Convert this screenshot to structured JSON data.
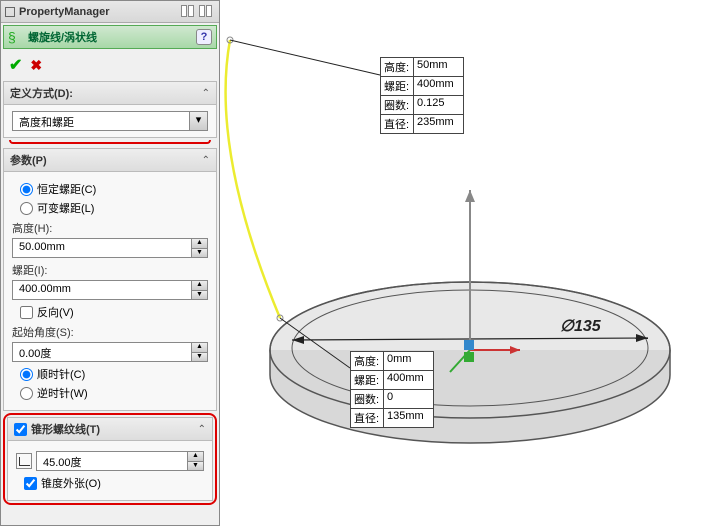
{
  "titlebar": {
    "title": "PropertyManager"
  },
  "feature": {
    "name": "螺旋线/涡状线"
  },
  "sections": {
    "def": {
      "title": "定义方式(D):",
      "dropdown": "高度和螺距"
    },
    "params": {
      "title": "参数(P)",
      "radio_const": "恒定螺距(C)",
      "radio_var": "可变螺距(L)",
      "height_label": "高度(H):",
      "height_val": "50.00mm",
      "pitch_label": "螺距(I):",
      "pitch_val": "400.00mm",
      "reverse": "反向(V)",
      "start_angle_label": "起始角度(S):",
      "start_angle_val": "0.00度",
      "cw": "顺时针(C)",
      "ccw": "逆时针(W)"
    },
    "taper": {
      "title": "锥形螺纹线(T)",
      "angle": "45.00度",
      "outward": "锥度外张(O)"
    }
  },
  "callouts": {
    "top": {
      "height_l": "高度:",
      "height_v": "50mm",
      "pitch_l": "螺距:",
      "pitch_v": "400mm",
      "rev_l": "圈数:",
      "rev_v": "0.125",
      "dia_l": "直径:",
      "dia_v": "235mm"
    },
    "bottom": {
      "height_l": "高度:",
      "height_v": "0mm",
      "pitch_l": "螺距:",
      "pitch_v": "400mm",
      "rev_l": "圈数:",
      "rev_v": "0",
      "dia_l": "直径:",
      "dia_v": "135mm"
    }
  },
  "dim": {
    "phi": "∅135"
  }
}
